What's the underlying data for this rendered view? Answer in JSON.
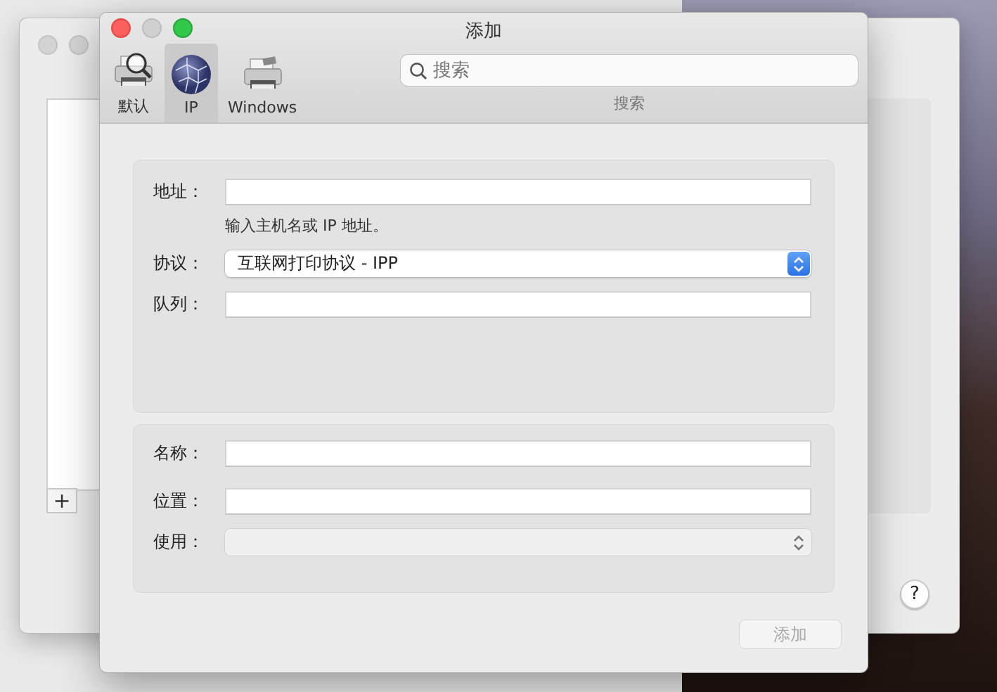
{
  "window": {
    "title": "添加"
  },
  "toolbar": {
    "tabs": [
      {
        "label": "默认",
        "kind": "default",
        "selected": false
      },
      {
        "label": "IP",
        "kind": "ip",
        "selected": true
      },
      {
        "label": "Windows",
        "kind": "windows",
        "selected": false
      }
    ],
    "search": {
      "placeholder": "搜索",
      "label": "搜索"
    }
  },
  "connection": {
    "fields": [
      {
        "label": "地址：",
        "kind": "text",
        "note": "输入主机名或 IP 地址。"
      },
      {
        "label": "协议：",
        "kind": "popup",
        "value": "互联网打印协议 - IPP",
        "disabled": false
      },
      {
        "label": "队列：",
        "kind": "text"
      }
    ]
  },
  "details": {
    "fields": [
      {
        "label": "名称：",
        "kind": "text"
      },
      {
        "label": "位置：",
        "kind": "text"
      },
      {
        "label": "使用：",
        "kind": "popup",
        "disabled": true
      }
    ]
  },
  "add_button": {
    "label": "添加",
    "disabled": true
  },
  "background_window": {
    "add_button": "+",
    "help_button": "?"
  }
}
